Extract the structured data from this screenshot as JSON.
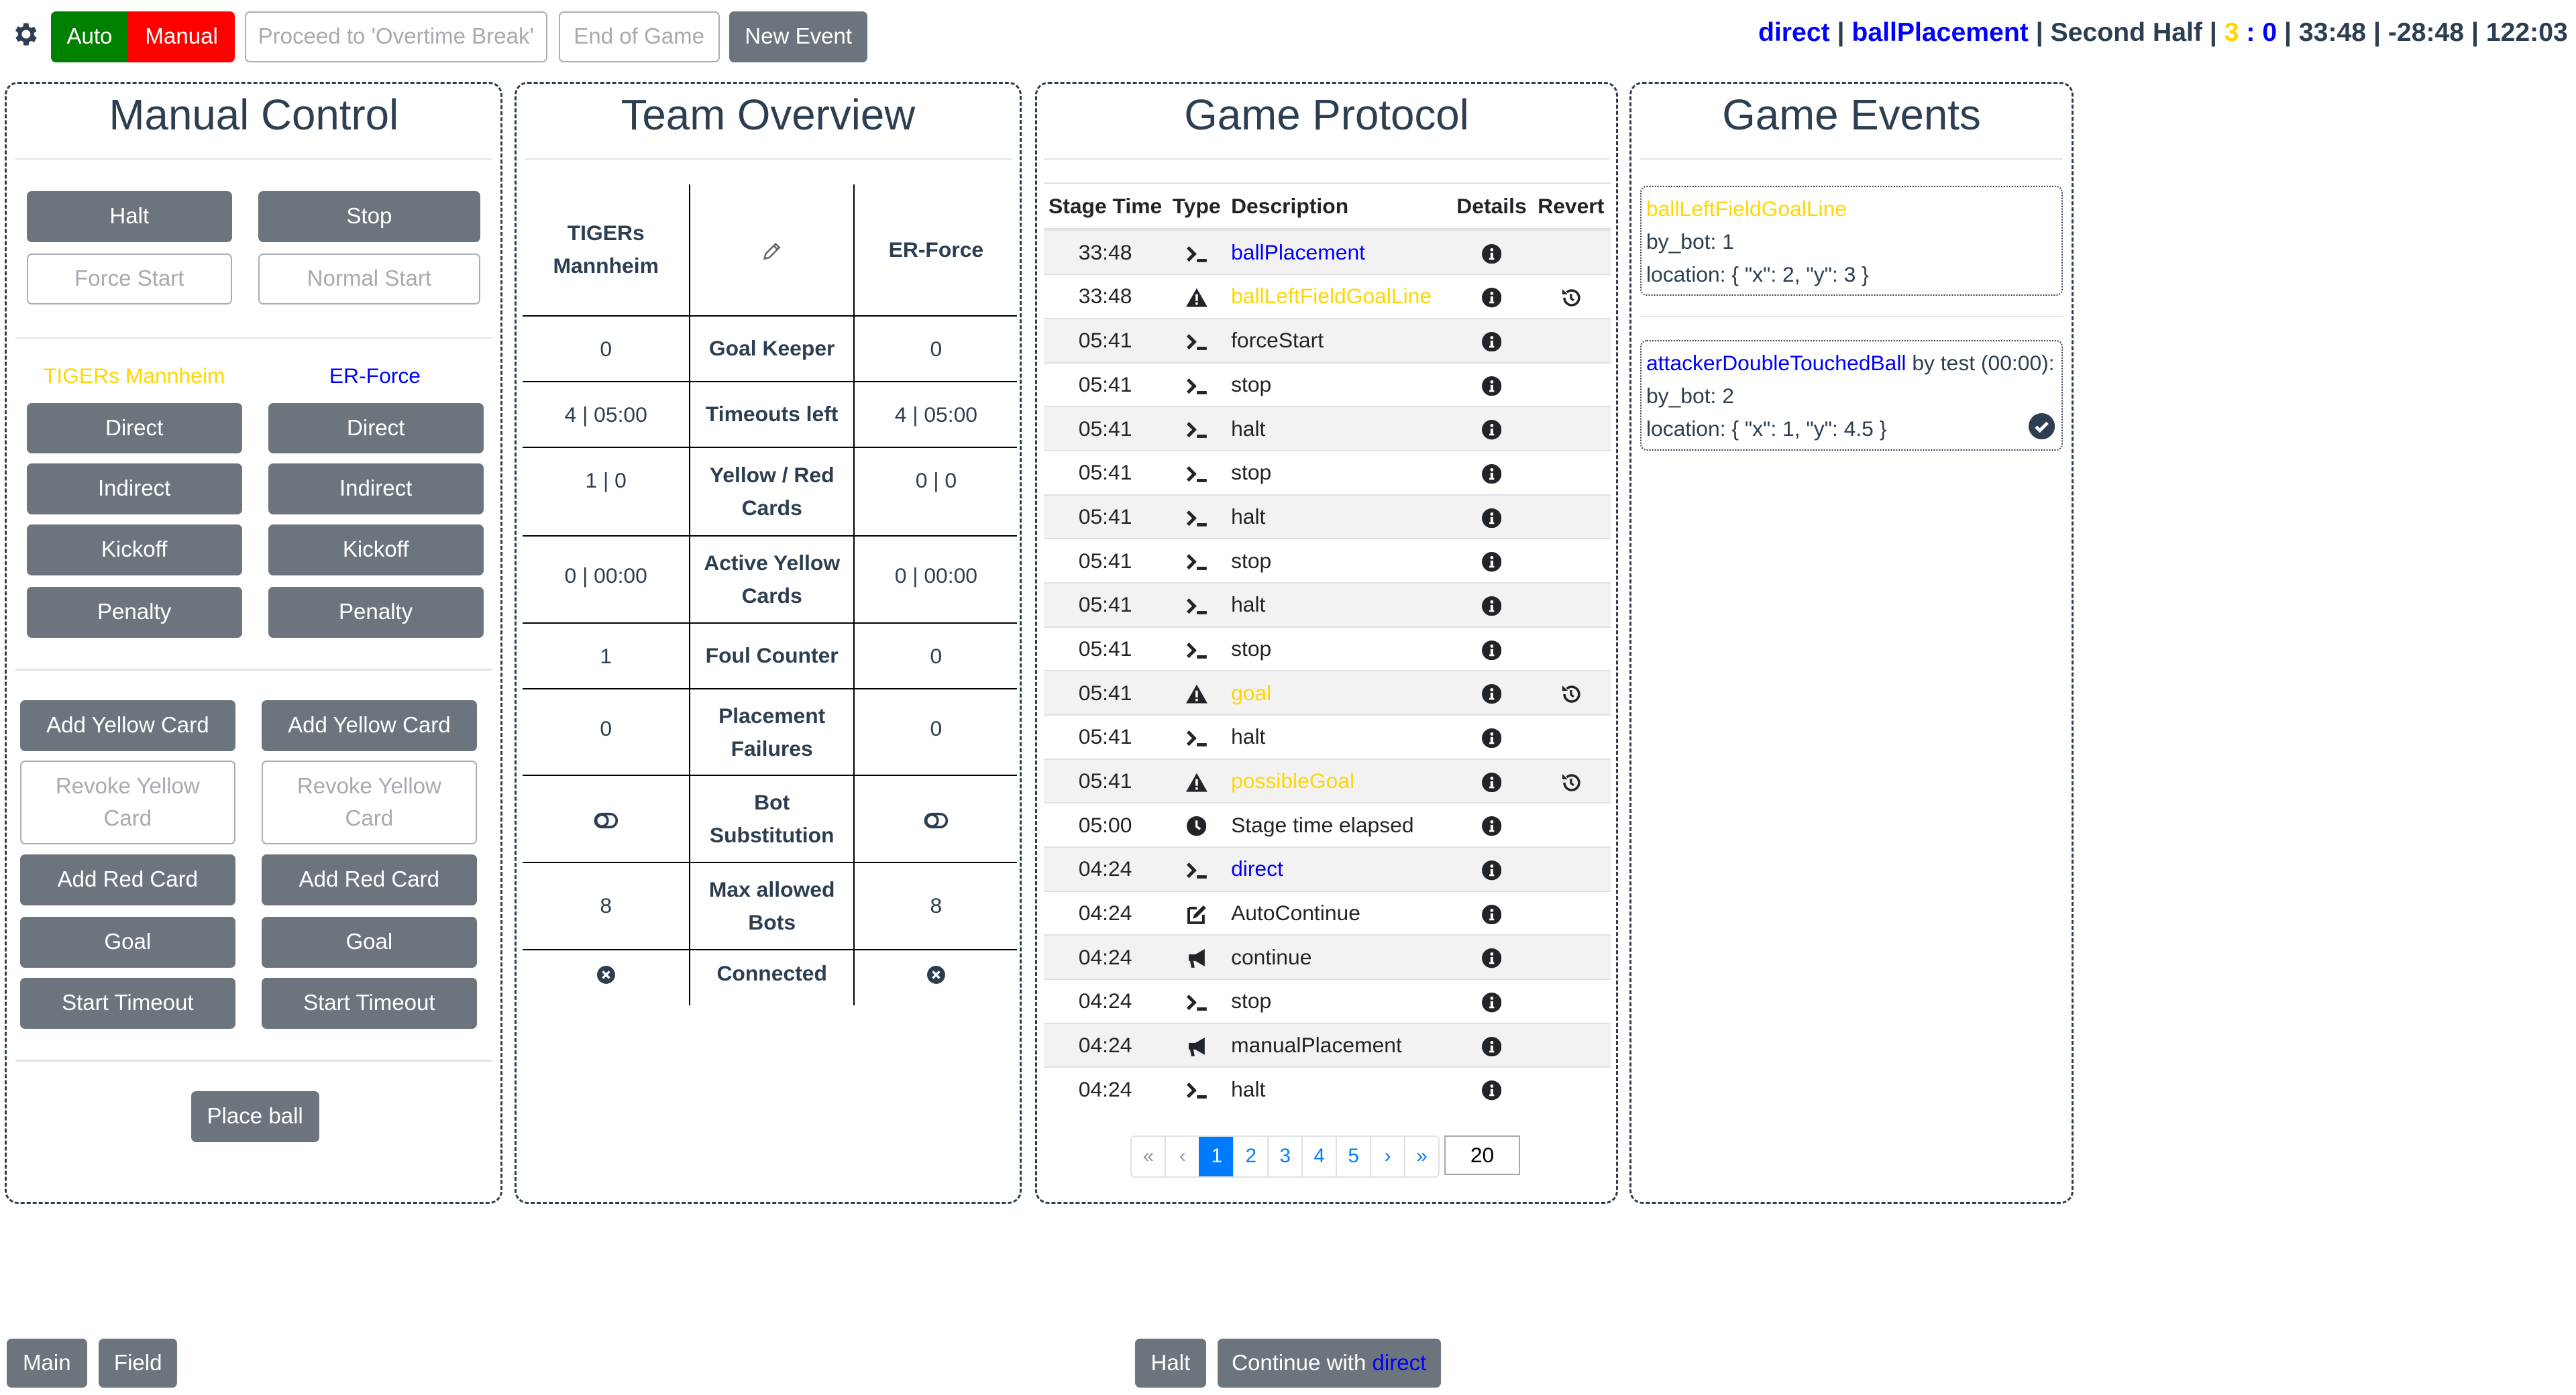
{
  "topbar": {
    "settings_icon": "gear-icon",
    "auto_label": "Auto",
    "manual_label": "Manual",
    "proceed_label": "Proceed to 'Overtime Break'",
    "end_of_game_label": "End of Game",
    "new_event_label": "New Event",
    "status": {
      "command": "direct",
      "next_command": "ballPlacement",
      "stage": "Second Half",
      "score_yellow": "3",
      "score_sep": ":",
      "score_blue": "0",
      "stage_time": "33:48",
      "stage_time_left": "-28:48",
      "match_time": "122:03",
      "separator": "|"
    }
  },
  "colors": {
    "yellow_team": "#ffd700",
    "blue_team": "#0000ff",
    "auto": "#008000",
    "manual": "#ff0000",
    "secondary": "#6c757d",
    "primary": "#007bff"
  },
  "manual_control": {
    "title": "Manual Control",
    "halt": "Halt",
    "stop": "Stop",
    "force_start": "Force Start",
    "normal_start": "Normal Start",
    "teams": [
      {
        "name": "TIGERs Mannheim",
        "direct": "Direct",
        "indirect": "Indirect",
        "kickoff": "Kickoff",
        "penalty": "Penalty",
        "add_yellow": "Add Yellow Card",
        "revoke_yellow": "Revoke Yellow Card",
        "add_red": "Add Red Card",
        "goal": "Goal",
        "timeout": "Start Timeout"
      },
      {
        "name": "ER-Force",
        "direct": "Direct",
        "indirect": "Indirect",
        "kickoff": "Kickoff",
        "penalty": "Penalty",
        "add_yellow": "Add Yellow Card",
        "revoke_yellow": "Revoke Yellow Card",
        "add_red": "Add Red Card",
        "goal": "Goal",
        "timeout": "Start Timeout"
      }
    ],
    "place_ball": "Place ball"
  },
  "team_overview": {
    "title": "Team Overview",
    "yellow_team": "TIGERs Mannheim",
    "blue_team": "ER-Force",
    "edit_icon": "pencil-icon",
    "rows": [
      {
        "label": "Goal Keeper",
        "yellow": "0",
        "blue": "0"
      },
      {
        "label": "Timeouts left",
        "yellow": "4 | 05:00",
        "blue": "4 | 05:00"
      },
      {
        "label": "Yellow / Red Cards",
        "yellow": "1 | 0",
        "blue": "0 | 0"
      },
      {
        "label": "Active Yellow Cards",
        "yellow": "0 | 00:00",
        "blue": "0 | 00:00"
      },
      {
        "label": "Foul Counter",
        "yellow": "1",
        "blue": "0"
      },
      {
        "label": "Placement Failures",
        "yellow": "0",
        "blue": "0"
      },
      {
        "label": "Bot Substitution",
        "yellow": "toggle-off-icon",
        "blue": "toggle-off-icon"
      },
      {
        "label": "Max allowed Bots",
        "yellow": "8",
        "blue": "8"
      },
      {
        "label": "Connected",
        "yellow": "times-circle-icon",
        "blue": "times-circle-icon"
      }
    ]
  },
  "game_protocol": {
    "title": "Game Protocol",
    "columns": [
      "Stage Time",
      "Type",
      "Description",
      "Details",
      "Revert"
    ],
    "rows": [
      {
        "time": "33:48",
        "type": "terminal",
        "desc": "ballPlacement",
        "color": "blue",
        "revert": false
      },
      {
        "time": "33:48",
        "type": "warning",
        "desc": "ballLeftFieldGoalLine",
        "color": "yellow",
        "revert": true
      },
      {
        "time": "05:41",
        "type": "terminal",
        "desc": "forceStart",
        "color": "",
        "revert": false
      },
      {
        "time": "05:41",
        "type": "terminal",
        "desc": "stop",
        "color": "",
        "revert": false
      },
      {
        "time": "05:41",
        "type": "terminal",
        "desc": "halt",
        "color": "",
        "revert": false
      },
      {
        "time": "05:41",
        "type": "terminal",
        "desc": "stop",
        "color": "",
        "revert": false
      },
      {
        "time": "05:41",
        "type": "terminal",
        "desc": "halt",
        "color": "",
        "revert": false
      },
      {
        "time": "05:41",
        "type": "terminal",
        "desc": "stop",
        "color": "",
        "revert": false
      },
      {
        "time": "05:41",
        "type": "terminal",
        "desc": "halt",
        "color": "",
        "revert": false
      },
      {
        "time": "05:41",
        "type": "terminal",
        "desc": "stop",
        "color": "",
        "revert": false
      },
      {
        "time": "05:41",
        "type": "warning",
        "desc": "goal",
        "color": "yellow",
        "revert": true
      },
      {
        "time": "05:41",
        "type": "terminal",
        "desc": "halt",
        "color": "",
        "revert": false
      },
      {
        "time": "05:41",
        "type": "warning",
        "desc": "possibleGoal",
        "color": "yellow",
        "revert": true
      },
      {
        "time": "05:00",
        "type": "clock",
        "desc": "Stage time elapsed",
        "color": "",
        "revert": false
      },
      {
        "time": "04:24",
        "type": "terminal",
        "desc": "direct",
        "color": "blue",
        "revert": false
      },
      {
        "time": "04:24",
        "type": "edit",
        "desc": "AutoContinue",
        "color": "",
        "revert": false
      },
      {
        "time": "04:24",
        "type": "bullhorn",
        "desc": "continue",
        "color": "",
        "revert": false
      },
      {
        "time": "04:24",
        "type": "terminal",
        "desc": "stop",
        "color": "",
        "revert": false
      },
      {
        "time": "04:24",
        "type": "bullhorn",
        "desc": "manualPlacement",
        "color": "",
        "revert": false
      },
      {
        "time": "04:24",
        "type": "terminal",
        "desc": "halt",
        "color": "",
        "revert": false
      }
    ],
    "pagination": {
      "first": "«",
      "prev": "‹",
      "pages": [
        "1",
        "2",
        "3",
        "4",
        "5"
      ],
      "current": "1",
      "next": "›",
      "last": "»"
    },
    "per_page": "20"
  },
  "game_events": {
    "title": "Game Events",
    "events": [
      {
        "type": "ballLeftFieldGoalLine",
        "color": "yellow",
        "suffix": "",
        "lines": [
          "by_bot: 1",
          "location: { \"x\": 2, \"y\": 3 }"
        ],
        "accepted": false
      },
      {
        "type": "attackerDoubleTouchedBall",
        "color": "blue",
        "suffix": " by test (00:00):",
        "lines": [
          "by_bot: 2",
          "location: { \"x\": 1, \"y\": 4.5 }"
        ],
        "accepted": true
      }
    ]
  },
  "bottom_bar": {
    "main": "Main",
    "field": "Field",
    "halt": "Halt",
    "continue_prefix": "Continue with ",
    "continue_command": "direct"
  }
}
